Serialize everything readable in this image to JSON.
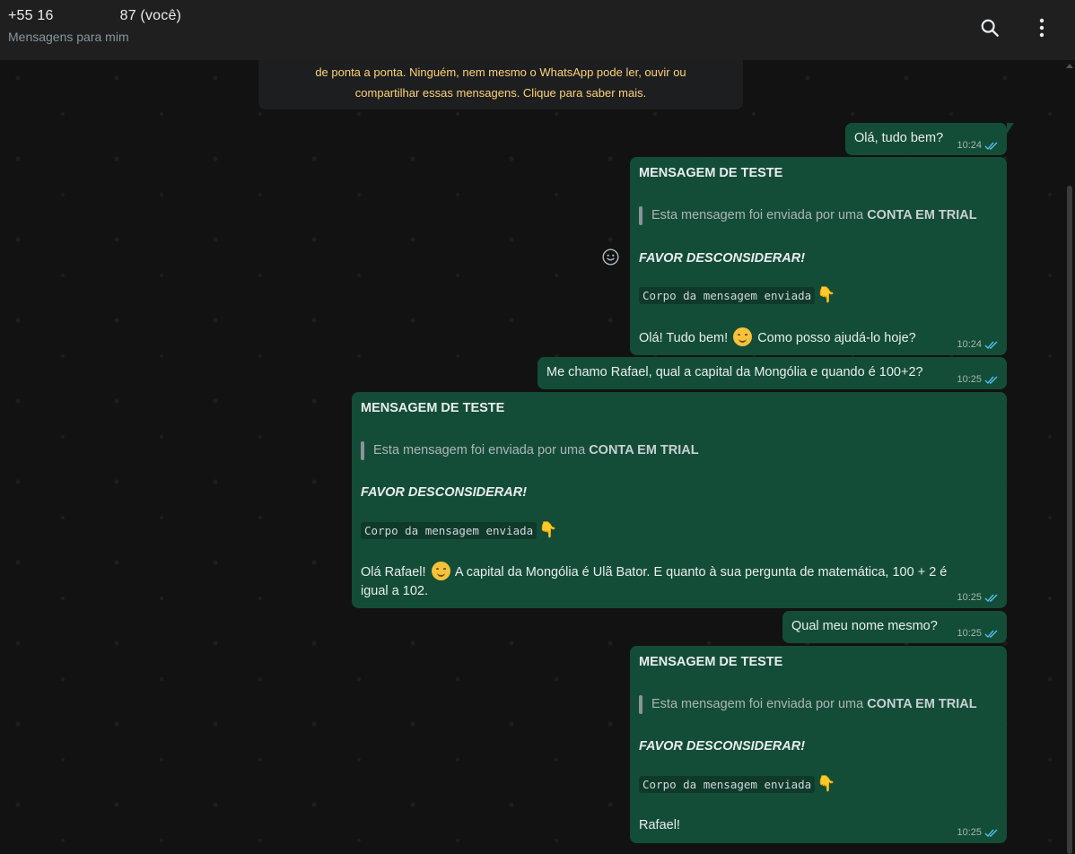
{
  "header": {
    "name_prefix": "+55 16",
    "name_suffix": "87 (você)",
    "subtitle": "Mensagens para mim"
  },
  "icons": {
    "search": "search-icon",
    "menu": "kebab-menu-icon",
    "emoji": "emoji-icon",
    "ticks": "double-check-icon"
  },
  "notice": {
    "line1": "de ponta a ponta. Ninguém, nem mesmo o WhatsApp pode ler, ouvir ou",
    "line2": "compartilhar essas mensagens. Clique para saber mais."
  },
  "messages": [
    {
      "text": "Olá, tudo bem?",
      "time": "10:24"
    },
    {
      "title": "MENSAGEM DE TESTE",
      "quote_text": "Esta mensagem foi enviada por uma ",
      "quote_bold": "CONTA EM TRIAL",
      "warning": "FAVOR DESCONSIDERAR!",
      "code": "Corpo da mensagem enviada",
      "body_a": "Olá! Tudo bem!",
      "body_b": "Como posso ajudá-lo hoje?",
      "time": "10:24"
    },
    {
      "text": "Me chamo Rafael, qual a capital da Mongólia e quando é 100+2?",
      "time": "10:25"
    },
    {
      "title": "MENSAGEM DE TESTE",
      "quote_text": "Esta mensagem foi enviada por uma ",
      "quote_bold": "CONTA EM TRIAL",
      "warning": "FAVOR DESCONSIDERAR!",
      "code": "Corpo da mensagem enviada",
      "body_a": "Olá Rafael!",
      "body_b": "A capital da Mongólia é Ulã Bator. E quanto à sua pergunta de matemática, 100 + 2 é",
      "body_c": "igual a 102.",
      "time": "10:25"
    },
    {
      "text": "Qual meu nome mesmo?",
      "time": "10:25"
    },
    {
      "title": "MENSAGEM DE TESTE",
      "quote_text": "Esta mensagem foi enviada por uma ",
      "quote_bold": "CONTA EM TRIAL",
      "warning": "FAVOR DESCONSIDERAR!",
      "code": "Corpo da mensagem enviada",
      "body_a": "Rafael!",
      "time": "10:25"
    }
  ],
  "colors": {
    "bubble_out": "#144d37",
    "notice_text": "#ffd279",
    "read_ticks": "#53bdeb"
  }
}
